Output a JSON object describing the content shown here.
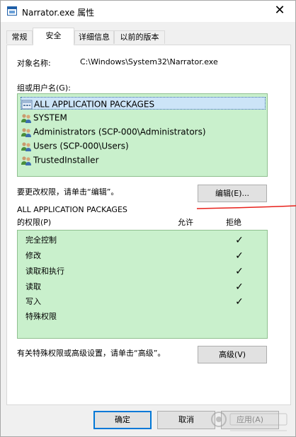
{
  "window": {
    "title": "Narrator.exe 属性",
    "close_glyph": "✕",
    "tabs": [
      {
        "label": "常规",
        "active": false
      },
      {
        "label": "安全",
        "active": true
      },
      {
        "label": "详细信息",
        "active": false
      },
      {
        "label": "以前的版本",
        "active": false
      }
    ]
  },
  "security": {
    "object_name_label": "对象名称:",
    "object_name_value": "C:\\Windows\\System32\\Narrator.exe",
    "group_label": "组或用户名(G):",
    "groups": [
      {
        "name": "ALL APPLICATION PACKAGES",
        "icon": "package-icon",
        "selected": true
      },
      {
        "name": "SYSTEM",
        "icon": "users-icon",
        "selected": false
      },
      {
        "name": "Administrators (SCP-000\\Administrators)",
        "icon": "users-icon",
        "selected": false
      },
      {
        "name": "Users (SCP-000\\Users)",
        "icon": "users-icon",
        "selected": false
      },
      {
        "name": "TrustedInstaller",
        "icon": "users-icon",
        "selected": false
      }
    ],
    "change_perm_text": "要更改权限，请单击“编辑”。",
    "edit_button": "编辑(E)...",
    "perm_heading_line1": "ALL APPLICATION PACKAGES",
    "perm_heading_line2": "的权限(P)",
    "col_allow": "允许",
    "col_deny": "拒绝",
    "check_glyph": "✓",
    "permissions": [
      {
        "name": "完全控制",
        "allow": false,
        "deny": true
      },
      {
        "name": "修改",
        "allow": false,
        "deny": true
      },
      {
        "name": "读取和执行",
        "allow": false,
        "deny": true
      },
      {
        "name": "读取",
        "allow": false,
        "deny": true
      },
      {
        "name": "写入",
        "allow": false,
        "deny": true
      },
      {
        "name": "特殊权限",
        "allow": false,
        "deny": false
      }
    ],
    "advanced_text": "有关特殊权限或高级设置，请单击“高级”。",
    "advanced_button": "高级(V)"
  },
  "footer": {
    "ok_button": "确定",
    "cancel_button": "取消",
    "apply_button": "应用(A)"
  },
  "colors": {
    "highlight_green": "#c9f0cc",
    "annotation_red": "#e8201a",
    "focus_blue": "#0078d7"
  }
}
